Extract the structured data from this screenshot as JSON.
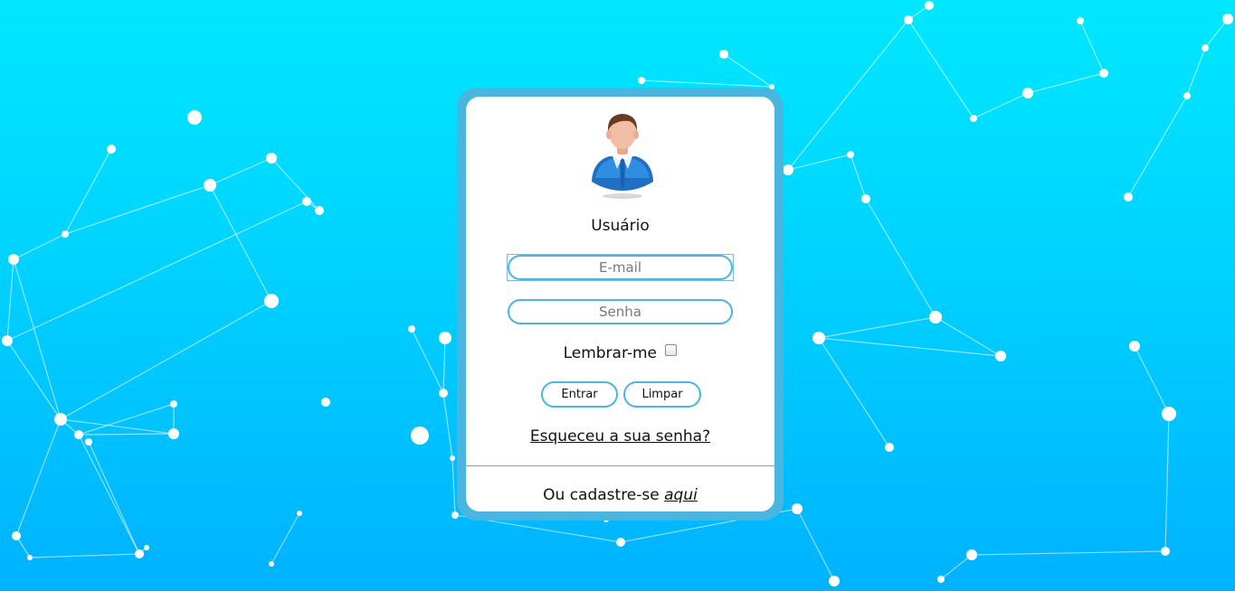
{
  "colors": {
    "background_top": "#00e8ff",
    "background_bottom": "#00b2ff",
    "card_border": "#4ab5de",
    "card_background": "#ffffff"
  },
  "login": {
    "avatar_icon": "user-avatar-icon",
    "title": "Usuário",
    "email": {
      "placeholder": "E-mail",
      "value": ""
    },
    "password": {
      "placeholder": "Senha",
      "value": ""
    },
    "remember_label": "Lembrar-me",
    "remember_checked": false,
    "submit_label": "Entrar",
    "clear_label": "Limpar",
    "forgot_link": "Esqueceu a sua senha?",
    "signup_prefix": "Ou cadastre-se",
    "signup_link": "aqui"
  }
}
